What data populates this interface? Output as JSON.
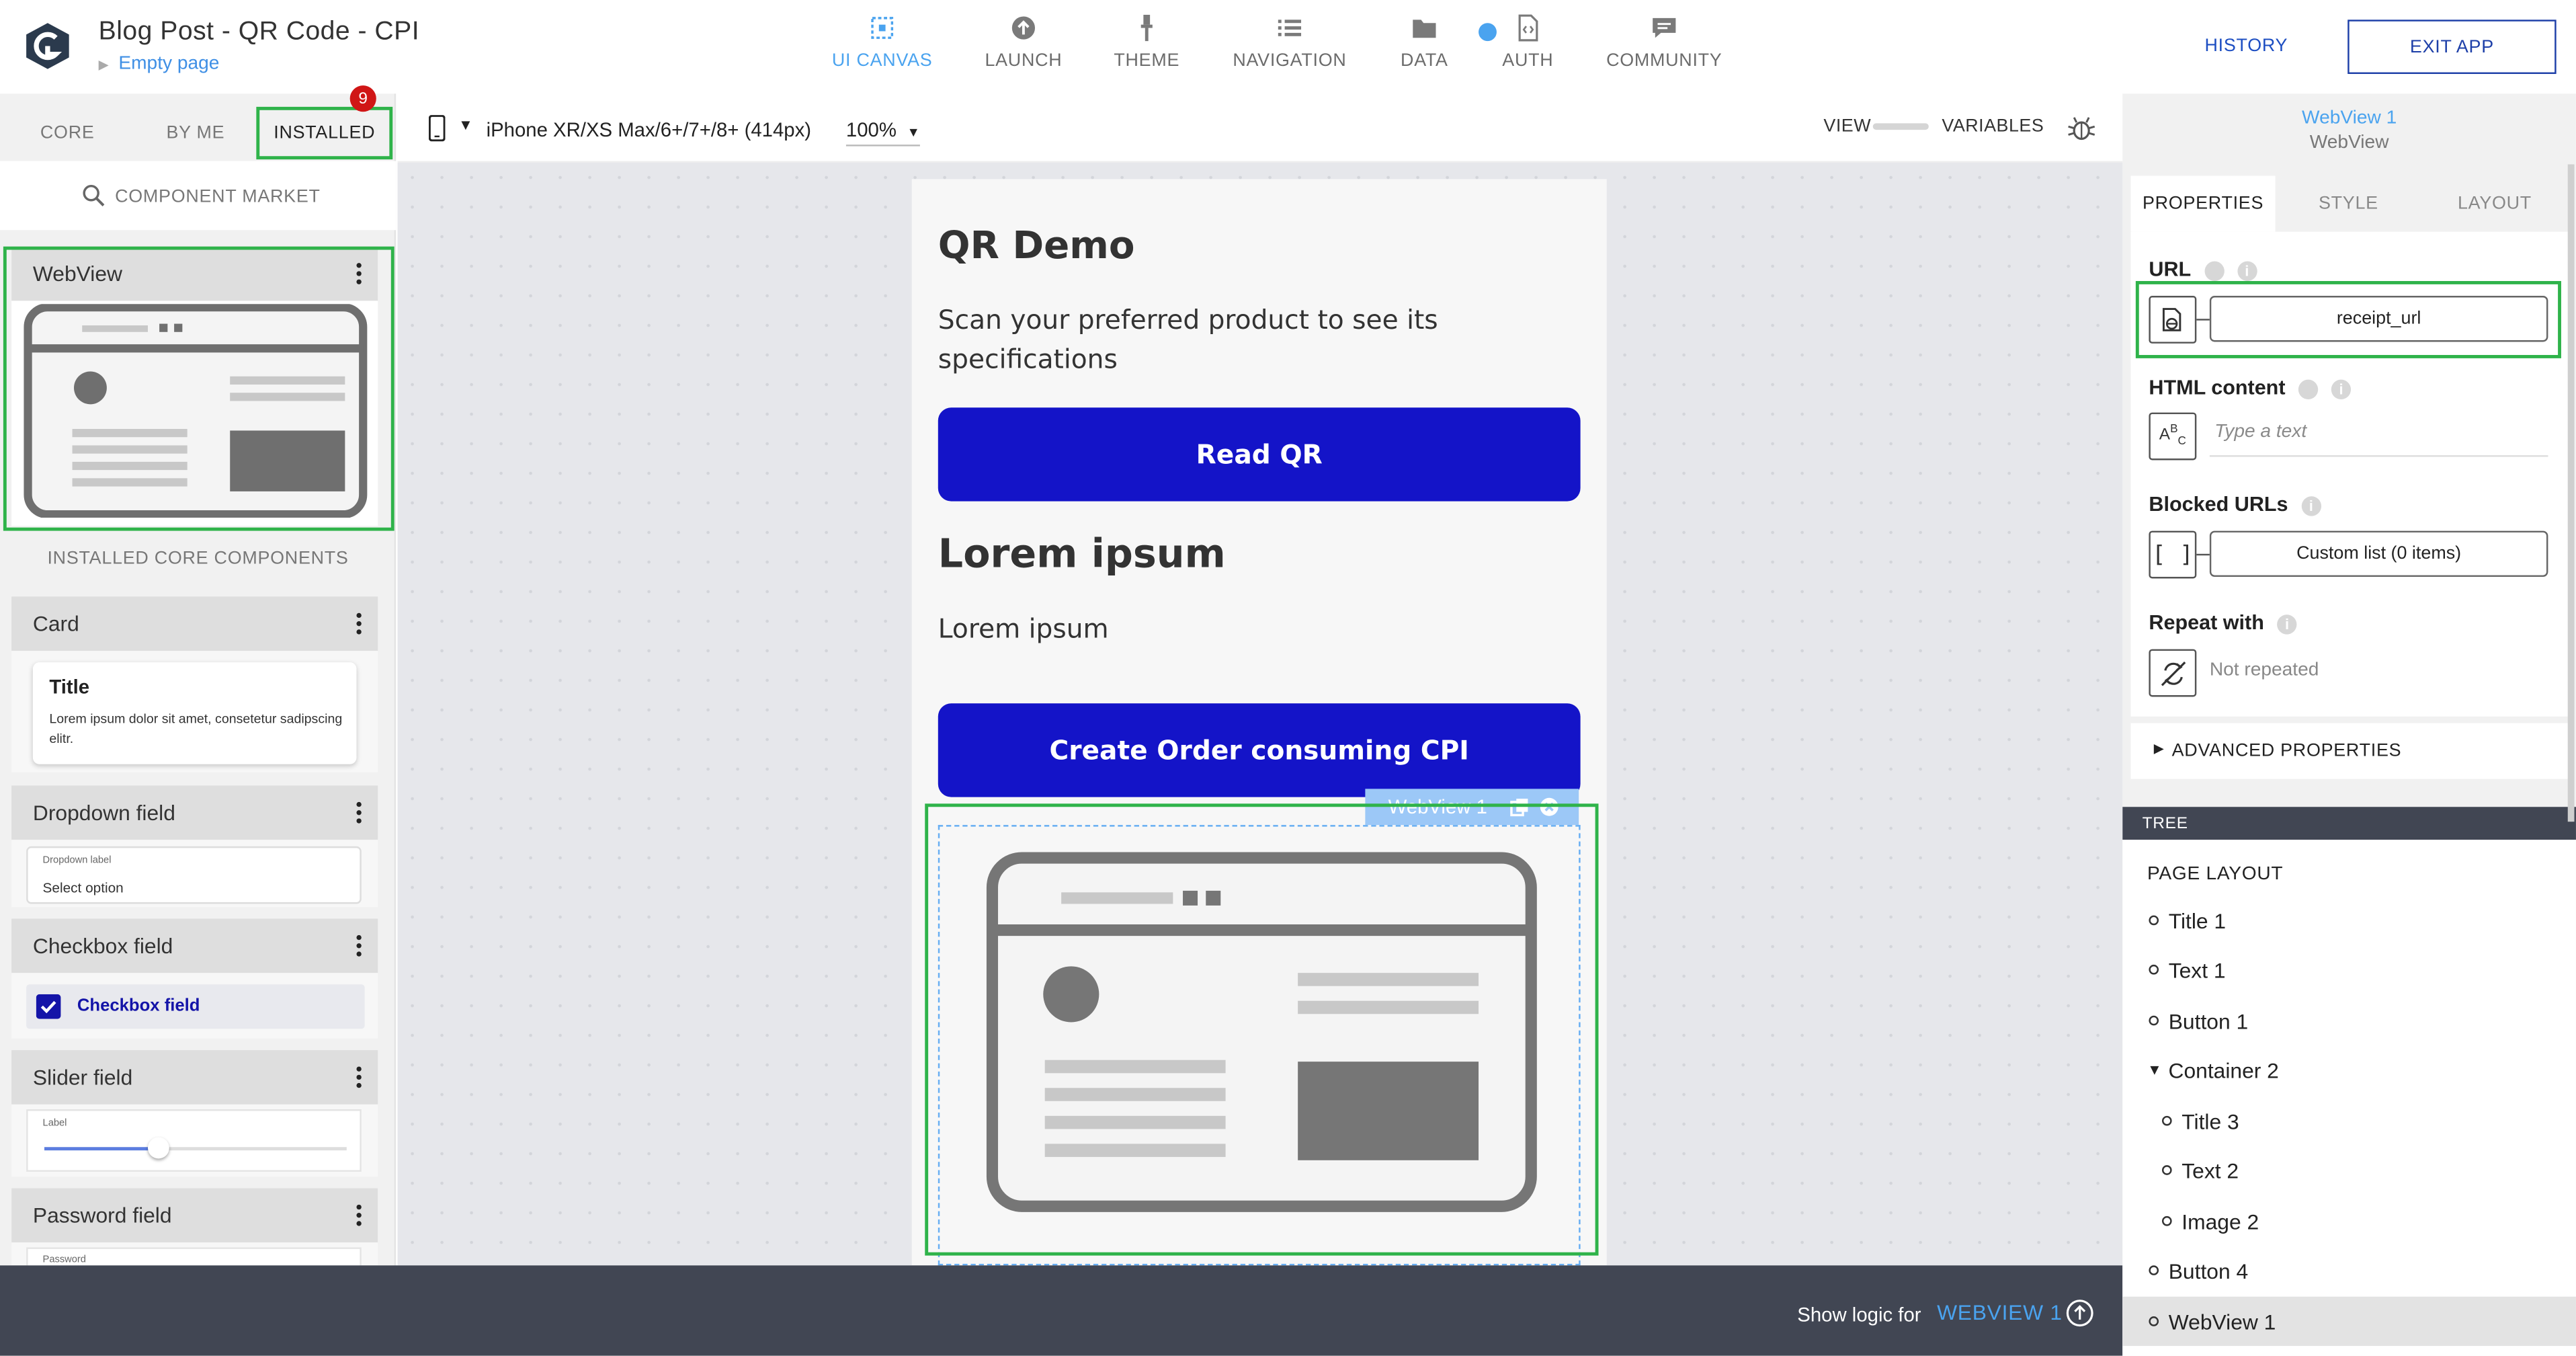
{
  "header": {
    "app_title": "Blog Post - QR Code - CPI",
    "page_name": "Empty page",
    "nav": [
      {
        "label": "UI CANVAS",
        "icon": "ui-canvas-icon",
        "active": true
      },
      {
        "label": "LAUNCH",
        "icon": "launch-icon"
      },
      {
        "label": "THEME",
        "icon": "theme-icon"
      },
      {
        "label": "NAVIGATION",
        "icon": "navigation-icon"
      },
      {
        "label": "DATA",
        "icon": "folder-icon"
      },
      {
        "label": "AUTH",
        "icon": "auth-file-icon"
      },
      {
        "label": "COMMUNITY",
        "icon": "chat-icon"
      }
    ],
    "history_label": "HISTORY",
    "exit_label": "EXIT APP",
    "accent_color": "#4aa3ef"
  },
  "left_panel": {
    "tabs": [
      "CORE",
      "BY ME",
      "INSTALLED"
    ],
    "active_tab": "INSTALLED",
    "market_label": "COMPONENT MARKET",
    "market_badge": "9",
    "installed_components": [
      {
        "name": "WebView"
      }
    ],
    "core_section_label": "INSTALLED CORE COMPONENTS",
    "core_components": [
      {
        "name": "Card",
        "preview_title": "Title",
        "preview_text": "Lorem ipsum dolor sit amet, consetetur sadipscing elitr."
      },
      {
        "name": "Dropdown field",
        "preview_label": "Dropdown label",
        "preview_value": "Select option"
      },
      {
        "name": "Checkbox field",
        "preview_label": "Checkbox field",
        "checked": true
      },
      {
        "name": "Slider field",
        "preview_label": "Label",
        "preview_value": 0.38
      },
      {
        "name": "Password field",
        "preview_label": "Password"
      }
    ]
  },
  "canvas_toolbar": {
    "device": "iPhone XR/XS Max/6+/7+/8+ (414px)",
    "zoom": "100%",
    "view_label": "VIEW",
    "variables_label": "VARIABLES"
  },
  "canvas": {
    "title": "QR Demo",
    "description": "Scan your preferred product to see its specifications",
    "read_button": "Read QR",
    "section_title": "Lorem ipsum",
    "section_text": "Lorem ipsum",
    "order_button": "Create Order consuming CPI",
    "selected_tag": "WebView 1",
    "button_color": "#1414c8"
  },
  "logic_bar": {
    "label": "Show logic for",
    "target": "WEBVIEW 1"
  },
  "right_panel": {
    "selected_name": "WebView 1",
    "selected_type": "WebView",
    "tabs": [
      "PROPERTIES",
      "STYLE",
      "LAYOUT"
    ],
    "active_tab": "PROPERTIES",
    "props": {
      "url_label": "URL",
      "url_value": "receipt_url",
      "html_label": "HTML content",
      "html_placeholder": "Type a text",
      "blocked_label": "Blocked URLs",
      "blocked_value": "Custom list (0 items)",
      "repeat_label": "Repeat with",
      "repeat_value": "Not repeated"
    },
    "advanced_label": "ADVANCED PROPERTIES",
    "tree_header": "TREE",
    "tree_title": "PAGE LAYOUT",
    "tree": [
      {
        "label": "Title 1",
        "depth": 0
      },
      {
        "label": "Text 1",
        "depth": 0
      },
      {
        "label": "Button 1",
        "depth": 0
      },
      {
        "label": "Container 2",
        "depth": 0,
        "expanded": true
      },
      {
        "label": "Title 3",
        "depth": 1
      },
      {
        "label": "Text 2",
        "depth": 1
      },
      {
        "label": "Image 2",
        "depth": 1
      },
      {
        "label": "Button 4",
        "depth": 0
      },
      {
        "label": "WebView 1",
        "depth": 0,
        "selected": true
      }
    ]
  }
}
